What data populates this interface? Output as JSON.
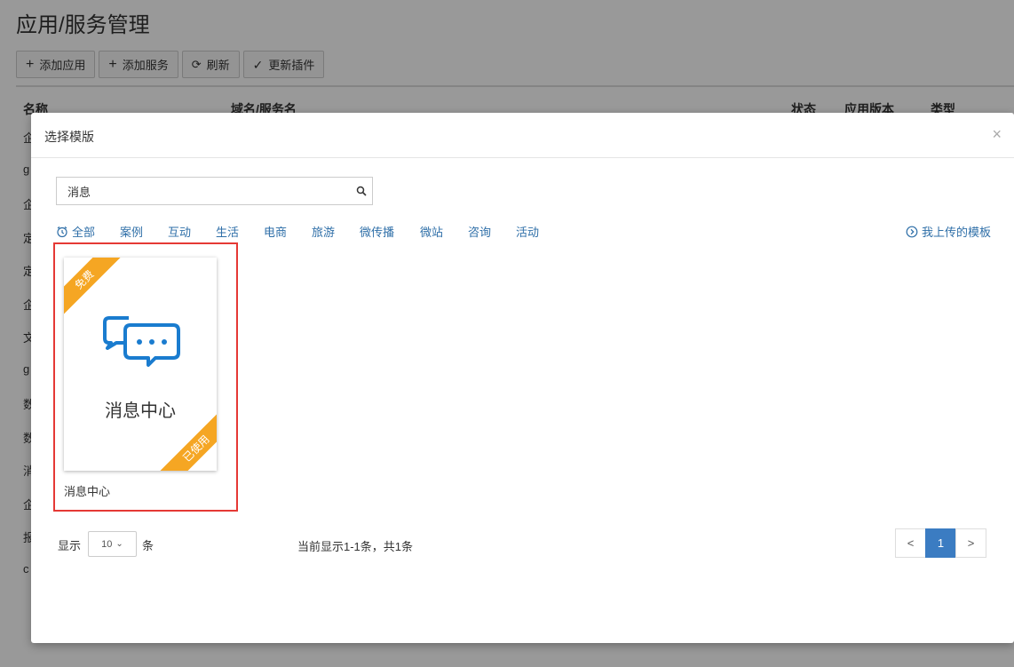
{
  "page": {
    "title": "应用/服务管理",
    "toolbar": [
      {
        "icon": "plus-icon",
        "label": "添加应用"
      },
      {
        "icon": "plus-icon",
        "label": "添加服务"
      },
      {
        "icon": "refresh-icon",
        "label": "刷新"
      },
      {
        "icon": "check-icon",
        "label": "更新插件"
      }
    ],
    "table_headers": [
      "名称",
      "域名/服务名",
      "状态",
      "应用版本",
      "类型"
    ],
    "row_first_chars": [
      "企",
      "g",
      "企",
      "定",
      "定",
      "企",
      "文",
      "g",
      "数",
      "数",
      "消",
      "企",
      "报",
      "c"
    ]
  },
  "modal": {
    "title": "选择模版",
    "close_symbol": "×",
    "search": {
      "value": "消息",
      "icon": "search-icon"
    },
    "categories": [
      "全部",
      "案例",
      "互动",
      "生活",
      "电商",
      "旅游",
      "微传播",
      "微站",
      "咨询",
      "活动"
    ],
    "uploaded_link": "我上传的模板",
    "templates": [
      {
        "title": "消息中心",
        "caption": "消息中心",
        "ribbon_top": "免费",
        "ribbon_bottom": "已使用",
        "icon": "chat-bubbles-icon"
      }
    ],
    "footer": {
      "show_label": "显示",
      "page_size": "10",
      "unit_label": "条",
      "summary": "当前显示1-1条，共1条"
    },
    "pagination": {
      "prev": "<",
      "current": "1",
      "next": ">"
    }
  },
  "colors": {
    "accent": "#3b7cc2",
    "link": "#2f6fa8",
    "ribbon": "#f5a623",
    "highlight": "#e53935",
    "icon_blue": "#1a7ccf"
  }
}
